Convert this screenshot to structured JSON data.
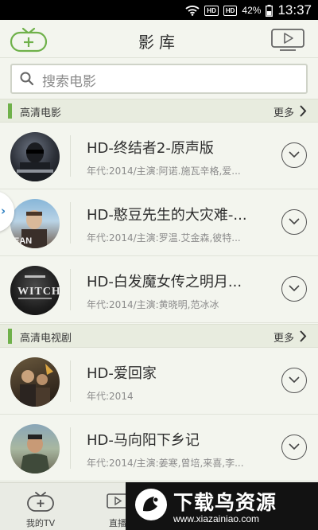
{
  "status_bar": {
    "battery": "42%",
    "time": "13:37",
    "sim_label": "HD"
  },
  "header": {
    "title": "影库",
    "add_icon": "tv-add-icon",
    "play_icon": "play-screen-icon"
  },
  "search": {
    "placeholder": "搜索电影"
  },
  "sections": [
    {
      "label": "高清电影",
      "more": "更多",
      "items": [
        {
          "name": "HD-终结者2-原声版",
          "meta": "年代:2014/主演:阿诺.施瓦辛格,爱..."
        },
        {
          "name": "HD-憨豆先生的大灾难-...",
          "meta": "年代:2014/主演:罗温.艾金森,彼特..."
        },
        {
          "name": "HD-白发魔女传之明月...",
          "meta": "年代:2014/主演:黄晓明,范冰冰"
        }
      ]
    },
    {
      "label": "高清电视剧",
      "more": "更多",
      "items": [
        {
          "name": "HD-爱回家",
          "meta": "年代:2014"
        },
        {
          "name": "HD-马向阳下乡记",
          "meta": "年代:2014/主演:姜寒,曾培,来喜,李..."
        }
      ]
    }
  ],
  "tabs": [
    {
      "label": "我的TV",
      "icon": "tv-add-icon"
    },
    {
      "label": "直播",
      "icon": "play-screen-icon"
    }
  ],
  "watermark": {
    "title": "下载鸟资源",
    "url": "www.xiazainiao.com"
  },
  "colors": {
    "accent": "#6fb14a",
    "background": "#f3f5ee",
    "section_bg": "#e8ecdf"
  }
}
